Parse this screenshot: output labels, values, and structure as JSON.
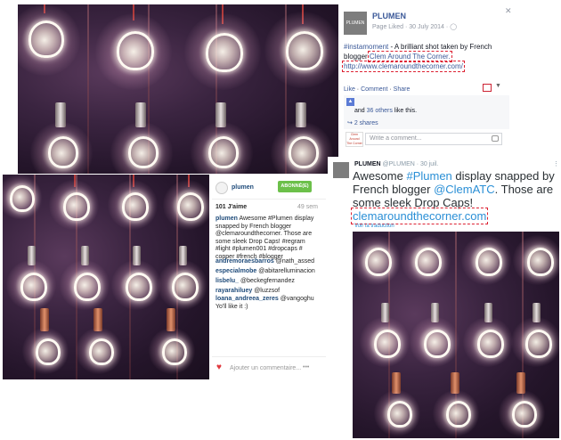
{
  "facebook": {
    "page_name": "PLUMEN",
    "avatar_text": "PLUMEN",
    "meta": "Page Liked · 30 July 2014 ·",
    "post_text_prefix": "#instamoment - A brilliant shot taken by French blogger",
    "blogger_link": "Clem Around The Corner.",
    "url": "http://www.clemaroundthecorner.com/",
    "actions": [
      "Like",
      "Comment",
      "Share"
    ],
    "likes_prefix": "and",
    "likes_link": "36 others",
    "likes_suffix": "like this.",
    "shares": "2 shares",
    "comment_avatar": "Clem Around The Corner",
    "comment_placeholder": "Write a comment..."
  },
  "instagram": {
    "username": "plumen",
    "follow_button": "ABONNÉ(E)",
    "likes": "101 J'aime",
    "time": "49 sem",
    "caption_user": "plumen",
    "caption": "Awesome #Plumen display snapped by French blogger @clemaroundthecorner. Those are some sleek Drop Caps! #regram #light #plumen001 #dropcaps # copper #french #blogger",
    "comments": [
      {
        "user": "andremoraesbarros",
        "text": "@nath_assed"
      },
      {
        "user": "especialmobe",
        "text": "@abitarelluminacion"
      },
      {
        "user": "lisbelu_",
        "text": "@beckegfernandez"
      },
      {
        "user": "rayarahiluey",
        "text": "@luzzsof"
      },
      {
        "user": "loana_andreea_zeres",
        "text": "@vangoghu Yo'll like it :)"
      }
    ],
    "add_comment": "Ajouter un commentaire...",
    "more": "•••"
  },
  "twitter": {
    "name": "PLUMEN",
    "handle": "@PLUMEN · 30 juil.",
    "tweet_part1": "Awesome ",
    "hashtag": "#Plumen",
    "tweet_part2": " display snapped by French blogger ",
    "mention": "@ClemATC",
    "tweet_part3": ". Those are some sleek Drop Caps!",
    "link": "clemaroundthecorner.com",
    "translation": "Voir la traduction"
  },
  "colors": {
    "facebook_link": "#3b5998",
    "instagram_follow": "#6cc04a",
    "twitter_link": "#2a8fd6",
    "annotation_dashes": "#dd2233"
  }
}
